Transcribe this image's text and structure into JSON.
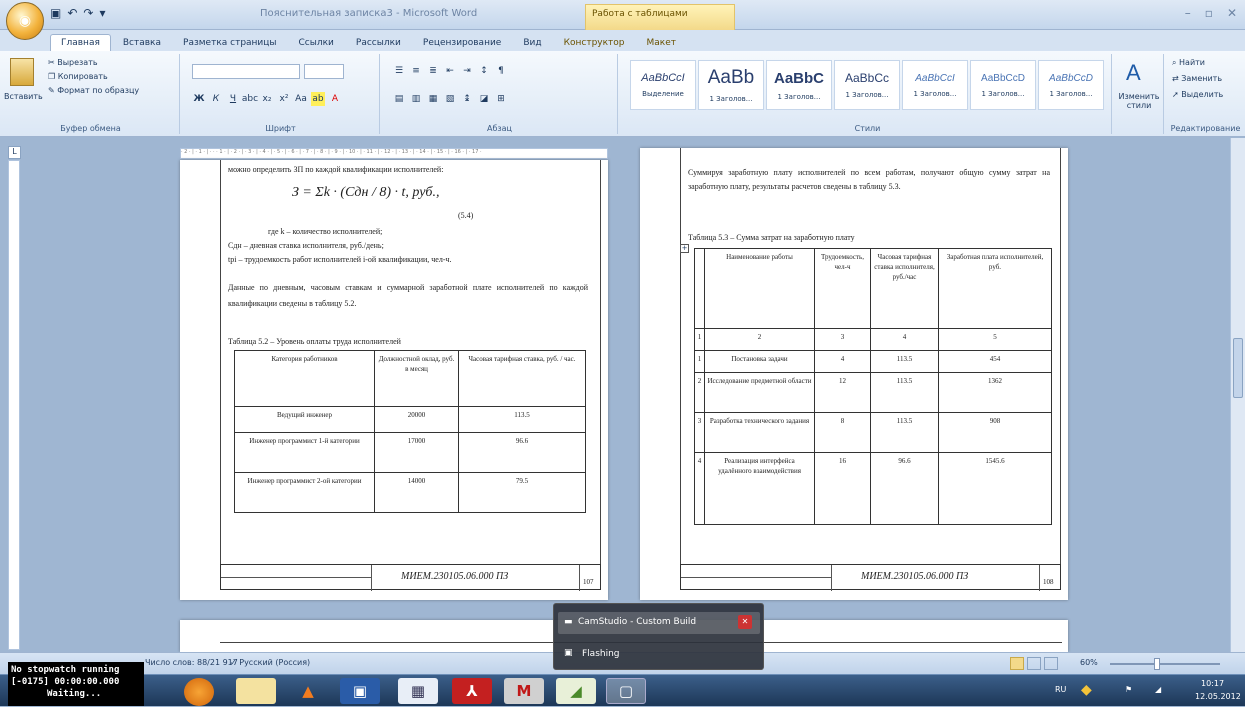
{
  "window": {
    "title": "Пояснительная записка3 - Microsoft Word",
    "context_tab": "Работа с таблицами",
    "quick_access": [
      "save-icon",
      "undo-icon",
      "redo-icon"
    ]
  },
  "tabs": [
    "Главная",
    "Вставка",
    "Разметка страницы",
    "Ссылки",
    "Рассылки",
    "Рецензирование",
    "Вид",
    "Конструктор",
    "Макет"
  ],
  "ribbon": {
    "clipboard": {
      "paste": "Вставить",
      "cut": "Вырезать",
      "copy": "Копировать",
      "format_painter": "Формат по образцу",
      "label": "Буфер обмена"
    },
    "font": {
      "label": "Шрифт"
    },
    "paragraph": {
      "label": "Абзац"
    },
    "styles": {
      "label": "Стили",
      "items": [
        {
          "preview": "AaBbCcI",
          "name": "Выделение"
        },
        {
          "preview": "AaBb",
          "name": "1 Заголов..."
        },
        {
          "preview": "AaBbC",
          "name": "1 Заголов..."
        },
        {
          "preview": "AaBbCc",
          "name": "1 Заголов..."
        },
        {
          "preview": "AaBbCcI",
          "name": "1 Заголов..."
        },
        {
          "preview": "AaBbCcD",
          "name": "1 Заголов..."
        },
        {
          "preview": "AaBbCcD",
          "name": "1 Заголов..."
        }
      ],
      "change_styles": "Изменить стили"
    },
    "editing": {
      "find": "Найти",
      "replace": "Заменить",
      "select": "Выделить",
      "label": "Редактирование"
    }
  },
  "left_page": {
    "intro": "можно определить ЗП по каждой квалификации исполнителей:",
    "formula": "З = Σk · (Cдн / 8) · t, руб.,",
    "formula_num": "(5.4)",
    "where1": "где k – количество исполнителей;",
    "where2": "Сдн – дневная ставка исполнителя, руб./день;",
    "where3": "tpi – трудоемкость работ исполнителей i-ой квалификации, чел-ч.",
    "para": "Данные по дневным, часовым ставкам и суммарной заработной плате исполнителей по каждой квалификации сведены в таблицу 5.2.",
    "table_caption": "Таблица 5.2 – Уровень оплаты труда исполнителей",
    "table_header": [
      "Категория работников",
      "Должностной оклад, руб. в месяц",
      "Часовая тарифная ставка, руб. / час."
    ],
    "table_rows": [
      [
        "Ведущий инженер",
        "20000",
        "113.5"
      ],
      [
        "Инженер программист 1-й категории",
        "17000",
        "96.6"
      ],
      [
        "Инженер программист 2-ой категории",
        "14000",
        "79.5"
      ]
    ],
    "stamp_code": "МИЕМ.230105.06.000 ПЗ",
    "page_no": "107"
  },
  "right_page": {
    "para": "Суммируя заработную плату исполнителей по всем работам, получают общую сумму затрат на заработную плату, результаты расчетов сведены в таблицу 5.3.",
    "table_caption": "Таблица 5.3 – Сумма затрат на заработную плату",
    "table_header": [
      "",
      "Наименование работы",
      "Трудоемкость, чел-ч",
      "Часовая тарифная ставка исполнителя, руб./час",
      "Заработная плата исполнителей, руб."
    ],
    "table_rows": [
      [
        "1",
        "2",
        "3",
        "4",
        "5"
      ],
      [
        "1",
        "Постановка задачи",
        "4",
        "113.5",
        "454"
      ],
      [
        "2",
        "Исследование предметной области",
        "12",
        "113.5",
        "1362"
      ],
      [
        "3",
        "Разработка технического задания",
        "8",
        "113.5",
        "908"
      ],
      [
        "4",
        "Реализация интерфейса удалённого взаимодействия",
        "16",
        "96.6",
        "1545.6"
      ]
    ],
    "stamp_code": "МИЕМ.230105.06.000 ПЗ",
    "page_no": "108"
  },
  "statusbar": {
    "words": "Число слов: 88/21 917",
    "language": "Русский (Россия)",
    "zoom": "60%"
  },
  "popup": {
    "item1": "CamStudio - Custom Build",
    "item2": "Flashing"
  },
  "stopwatch": {
    "line1": "No stopwatch running",
    "line2": "[-0175] 00:00:00.000",
    "line3": "Waiting..."
  },
  "tray": {
    "lang": "RU",
    "time": "10:17",
    "date": "12.05.2012"
  }
}
